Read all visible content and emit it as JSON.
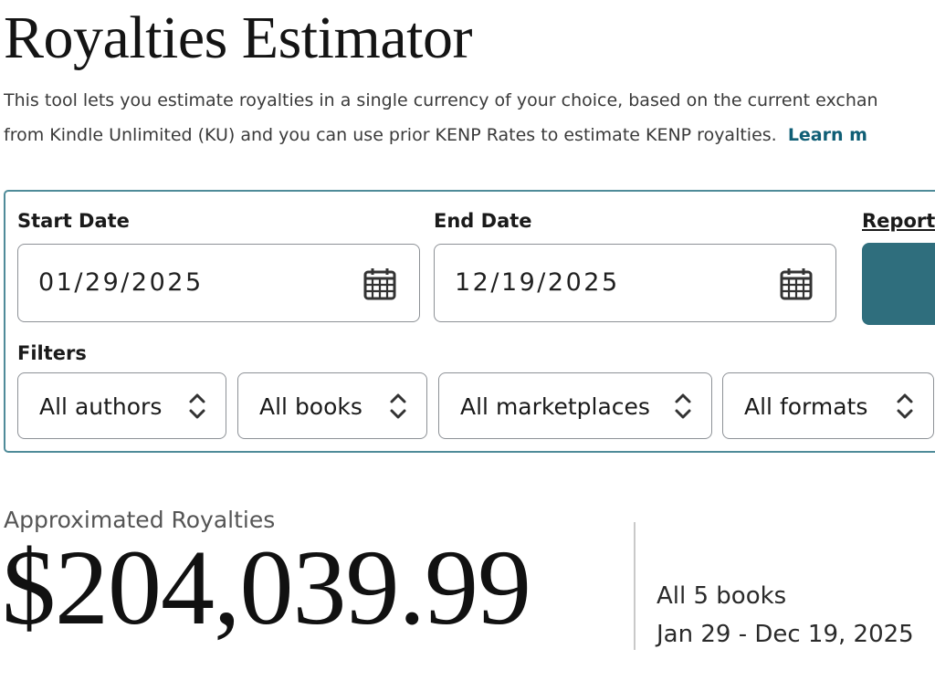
{
  "page": {
    "title": "Royalties Estimator",
    "description_line1": "This tool lets you estimate royalties in a single currency of your choice, based on the current exchan",
    "description_line2": "from Kindle Unlimited (KU) and you can use prior KENP Rates to estimate KENP royalties.",
    "learn_more": "Learn m"
  },
  "form": {
    "start_date": {
      "label": "Start Date",
      "value": "01/29/2025",
      "icon": "calendar-icon"
    },
    "end_date": {
      "label": "End Date",
      "value": "12/19/2025",
      "icon": "calendar-icon"
    },
    "report": {
      "label": "Report",
      "accent_color": "#2f6e7d"
    },
    "filters": {
      "label": "Filters",
      "authors": "All authors",
      "books": "All books",
      "marketplaces": "All marketplaces",
      "formats": "All formats"
    }
  },
  "results": {
    "label": "Approximated Royalties",
    "amount": "$204,039.99",
    "books": "All 5 books",
    "date_range": "Jan 29 - Dec 19, 2025"
  },
  "colors": {
    "panel_border": "#4f8b99",
    "link": "#0f5e75"
  }
}
